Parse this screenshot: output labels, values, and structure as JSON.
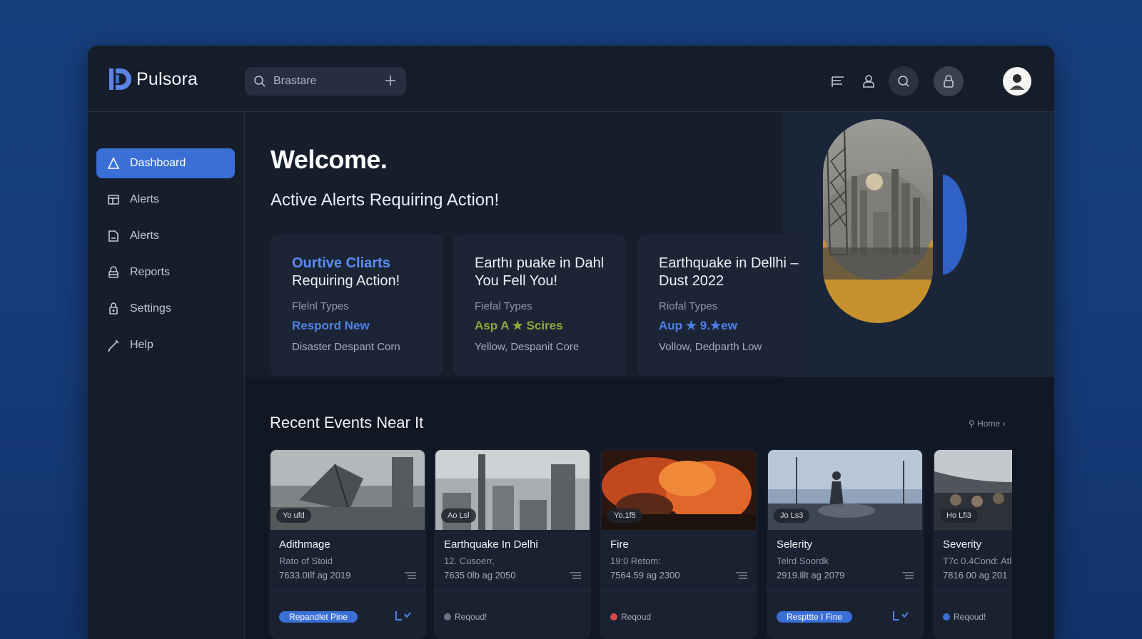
{
  "app": {
    "name": "Pulsora"
  },
  "search": {
    "placeholder": "Brastare"
  },
  "sidebar": {
    "items": [
      {
        "label": "Dashboard",
        "icon": "home-icon",
        "active": true
      },
      {
        "label": "Alerts",
        "icon": "alert-icon",
        "active": false
      },
      {
        "label": "Alerts",
        "icon": "file-icon",
        "active": false
      },
      {
        "label": "Reports",
        "icon": "lock-icon",
        "active": false
      },
      {
        "label": "Settings",
        "icon": "settings-icon",
        "active": false
      },
      {
        "label": "Help",
        "icon": "pencil-icon",
        "active": false
      }
    ]
  },
  "hero": {
    "welcome": "Welcome.",
    "subtitle": "Active Alerts Requiring Action!"
  },
  "alerts": [
    {
      "title_highlight": "Ourtive Cliarts",
      "title": "Requiring Action!",
      "type": "Flelnl Types",
      "action": "Respord New",
      "action_color": "#4f80e8",
      "footer": "Disaster Despant Corn"
    },
    {
      "title_highlight": "",
      "title": "Earthı puake in Dahl You Fell You!",
      "type": "Fiefal Types",
      "action": "Asp A ★ Scires",
      "action_color": "#8fa83a",
      "footer": "Yellow, Despanit Core"
    },
    {
      "title_highlight": "",
      "title": "Earthquake in Dellhi – Dust 2022",
      "type": "Riofal Types",
      "action": "Aup ★ 9.★ew",
      "action_color": "#4f80e8",
      "footer": "Vollow, Dedparth Low"
    }
  ],
  "events_section": {
    "title": "Recent Events Near It",
    "view_more": "⚲ Home ›"
  },
  "events": [
    {
      "tag": "Yo ufd",
      "title": "Adithmage",
      "sub": "Rato of Stoid",
      "date": "7633.0Ilf ag 2019",
      "action": "Repandlet Pine",
      "action_style": "button",
      "trend": true
    },
    {
      "tag": "Ao Lsl",
      "title": "Earthquake In Delhi",
      "sub": "12. Cusoerr,",
      "date": "7635 0lb ag 2050",
      "action": "Reqoud!",
      "action_style": "dot",
      "dot_color": "#6b7385",
      "trend": false
    },
    {
      "tag": "Yo.1f5",
      "title": "Fire",
      "sub": "19:0 Retom:",
      "date": "7564.59 ag 2300",
      "action": "Reqoud",
      "action_style": "dot",
      "dot_color": "#d94848",
      "trend": false
    },
    {
      "tag": "Jo Ls3",
      "title": "Selerity",
      "sub": "Telrd Soordk",
      "date": "2919.lllt ag 2079",
      "action": "Respttte I Fine",
      "action_style": "button",
      "trend": true
    },
    {
      "tag": "Ho Lfi3",
      "title": "Severity",
      "sub": "T7c 0.4Cond: Atl",
      "date": "7816 00 ag 201",
      "action": "Reqoud!",
      "action_style": "dot",
      "dot_color": "#3a6fd6",
      "trend": false
    }
  ],
  "colors": {
    "accent": "#3a6fd6",
    "background": "#131a26",
    "page_bg": "#163b78"
  }
}
